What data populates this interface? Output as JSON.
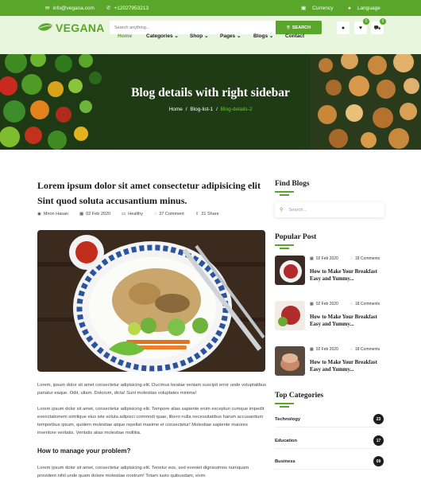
{
  "topbar": {
    "email": "info@vegana.com",
    "phone": "+12027953213",
    "currency": "Currency",
    "language": "Language"
  },
  "header": {
    "logo": "VEGANA",
    "search_placeholder": "Search anything...",
    "search_button": "SEARCH",
    "wishlist_count": "0",
    "cart_count": "0"
  },
  "nav": [
    {
      "label": "Home"
    },
    {
      "label": "Categories ⌄"
    },
    {
      "label": "Shop ⌄"
    },
    {
      "label": "Pages ⌄"
    },
    {
      "label": "Blogs ⌄"
    },
    {
      "label": "Contact"
    }
  ],
  "hero": {
    "title": "Blog details with right sidebar",
    "crumb_home": "Home",
    "crumb_list": "Blog-list-1",
    "crumb_current": "Blog-details-2",
    "sep": "/"
  },
  "post": {
    "title": "Lorem ipsum dolor sit amet consectetur adipisicing elit Sint quod soluta accusantium minus.",
    "author": "Miron Hasan",
    "date": "02 Feb 2020",
    "category": "Healthy",
    "comments": "37 Comment",
    "shares": "21 Share",
    "p1": "Lorem, ipsum dolor sit amet consectetur adipisicing elit. Ducimus beatae veniam suscipit error unde voluptatibus pariatur eaque. Odit, ullam. Dolorum, dicta! Sunt molestias voluptates minima!",
    "p2": "Lorem ipsum dolor sit amet, consectetur adipisicing elit. Tempore alias sapiente enim excepturi cumque impedit exercitationem similique eius iste soluta adipisci commodi quae, libero nulla necessitatibus harum accusantium temporibus ipsum, quidem molestiae atque repellat maxime et consectetur! Molestiae sapiente maiores inventore veritatis. Veritatis alias molestiae mollitia.",
    "subheading": "How to manage your problem?",
    "p3": "Lorem ipsum dolor sit amet, consectetur adipisicing elit. Tenetur eos, sed eveniet dignissimos numquam provident nihil unde quam dolore molestiae nostrum! Totam iusto quibusdam, enim"
  },
  "sidebar": {
    "find_title": "Find Blogs",
    "search_placeholder": "Search...",
    "popular_title": "Popular Post",
    "popular": [
      {
        "date": "02 Feb 2020",
        "comments": "18 Comments",
        "title": "How to Make Your Breakfast Easy and Yummy..."
      },
      {
        "date": "02 Feb 2020",
        "comments": "18 Comments",
        "title": "How to Make Your Breakfast Easy and Yummy..."
      },
      {
        "date": "02 Feb 2020",
        "comments": "18 Comments",
        "title": "How to Make Your Breakfast Easy and Yummy..."
      }
    ],
    "categories_title": "Top Categories",
    "categories": [
      {
        "name": "Technology",
        "count": "23"
      },
      {
        "name": "Education",
        "count": "17"
      },
      {
        "name": "Business",
        "count": "09"
      }
    ]
  },
  "colors": {
    "accent": "#5aa62a",
    "header_bg": "#e7f6dc",
    "hero_bg": "#1f3b16"
  }
}
